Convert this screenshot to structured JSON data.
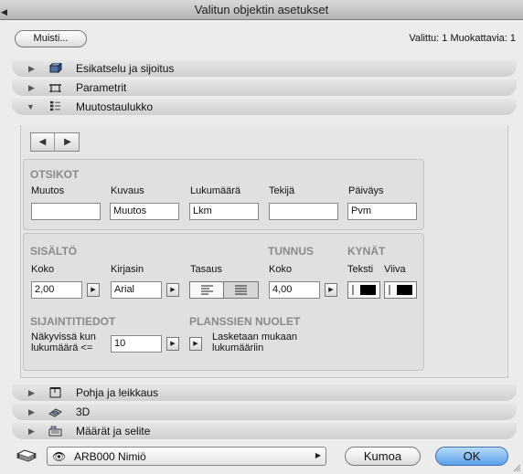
{
  "window": {
    "title": "Valitun objektin asetukset"
  },
  "toolbar": {
    "memory_label": "Muisti...",
    "selection_info": "Valittu: 1 Muokattavia: 1"
  },
  "sections": {
    "preview": "Esikatselu ja sijoitus",
    "parameters": "Parametrit",
    "revision": "Muutostaulukko",
    "floorplan": "Pohja ja leikkaus",
    "three_d": "3D",
    "listing": "Määrät ja selite"
  },
  "headers_group": {
    "title": "OTSIKOT",
    "columns": [
      {
        "label": "Muutos",
        "value": ""
      },
      {
        "label": "Kuvaus",
        "value": "Muutos"
      },
      {
        "label": "Lukumäärä",
        "value": "Lkm"
      },
      {
        "label": "Tekijä",
        "value": ""
      },
      {
        "label": "Päiväys",
        "value": "Pvm"
      }
    ]
  },
  "content_group": {
    "title": "SISÄLTÖ",
    "size_label": "Koko",
    "size_value": "2,00",
    "font_label": "Kirjasin",
    "font_value": "Arial",
    "align_label": "Tasaus"
  },
  "marker_group": {
    "title": "TUNNUS",
    "size_label": "Koko",
    "size_value": "4,00"
  },
  "pens_group": {
    "title": "KYNÄT",
    "text_label": "Teksti",
    "line_label": "Viiva"
  },
  "location_group": {
    "title": "SIJAINTITIEDOT",
    "visible_label_line1": "Näkyvissä kun",
    "visible_label_line2": "lukumäärä <=",
    "visible_value": "10"
  },
  "arrows_group": {
    "title": "PLANSSIEN NUOLET",
    "desc_line1": "Lasketaan mukaan",
    "desc_line2": "lukumääriin"
  },
  "footer": {
    "layer_value": "ARB000 Nimiö",
    "cancel_label": "Kumoa",
    "ok_label": "OK"
  },
  "colors": {
    "ok_button": "#5a9fe6",
    "group_title": "#8a8a8a"
  }
}
